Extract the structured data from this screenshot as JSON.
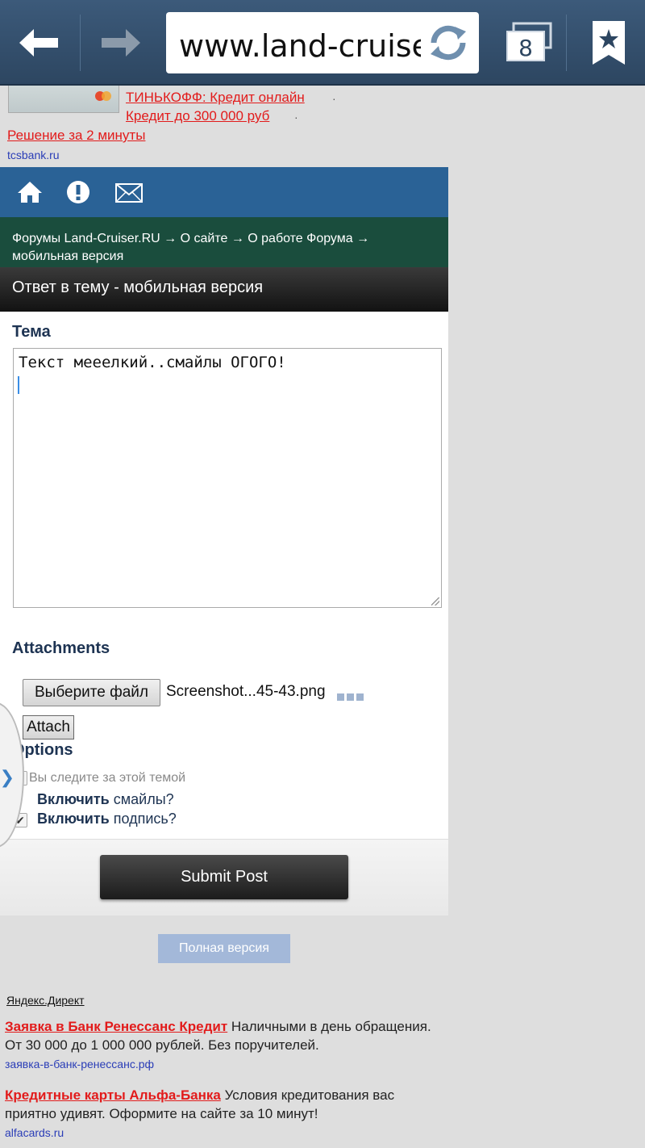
{
  "browser": {
    "url": "www.land-cruiser.ru",
    "tab_count": "8"
  },
  "top_ad": {
    "line1": "ТИНЬКОФФ: Кредит онлайн",
    "line2": "Кредит до 300 000 руб",
    "line3": "Решение за 2 минуты",
    "domain": "tcsbank.ru"
  },
  "forum": {
    "breadcrumb": "Форумы Land-Cruiser.RU → О сайте → О работе Форума → мобильная версия",
    "section_title": "Ответ в тему - мобильная версия",
    "subject_label": "Тема",
    "message_text": "Текст мееелкий..смайлы ОГОГО!",
    "attachments_label": "Attachments",
    "choose_file_label": "Выберите файл",
    "file_name": "Screenshot...45-43.png",
    "attach_label": "Attach",
    "options_label": "Options",
    "option_subscribed": "Вы следите за этой темой",
    "option_smilies_bold": "Включить",
    "option_smilies_rest": " смайлы?",
    "option_sig_bold": "Включить",
    "option_sig_rest": " подпись?",
    "submit_label": "Submit Post"
  },
  "full_version_label": "Полная версия",
  "yandex_direct": "Яндекс.Директ",
  "ads": [
    {
      "title": "Заявка в Банк Ренессанс Кредит",
      "text": " Наличными в день обращения. От 30 000 до 1 000 000 рублей. Без поручителей.",
      "url": "заявка-в-банк-ренессанс.рф"
    },
    {
      "title": "Кредитные карты Альфа-Банка",
      "text": " Условия кредитования вас приятно удивят. Оформите на сайте за 10 минут!",
      "url": "alfacards.ru"
    }
  ],
  "colors": {
    "toolbar": "#2d4661",
    "icon_bar": "#2a6296",
    "breadcrumb_bar": "#1a4d3d",
    "ad_red": "#e21b1b",
    "link_blue": "#2a3db7"
  }
}
